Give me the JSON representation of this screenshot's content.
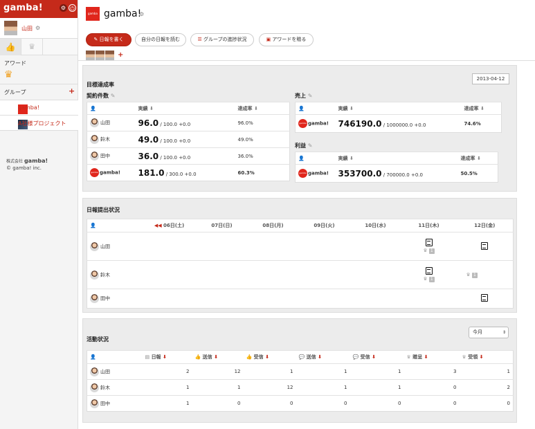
{
  "app": {
    "logo": "gamba!",
    "brand_color": "#c52a1a"
  },
  "sidebar": {
    "user_name": "山田",
    "awards_heading": "アワード",
    "groups_heading": "グループ",
    "groups": [
      {
        "label": "gamba!"
      },
      {
        "label": "A社様プロジェクト"
      }
    ],
    "company_label": "株式会社",
    "company_logo": "gamba!",
    "copyright": "© gamba! inc."
  },
  "header": {
    "title": "gamba!",
    "brand_badge": "gamba",
    "buttons": [
      {
        "label": "日報を書く",
        "icon": "pencil-icon"
      },
      {
        "label": "自分の日報を読む"
      },
      {
        "label": "グループの進捗状況",
        "icon": "list-icon"
      },
      {
        "label": "アワードを贈る",
        "icon": "gift-icon"
      }
    ]
  },
  "goals": {
    "title": "目標達成率",
    "date": "2013-04-12",
    "contracts": {
      "title": "契約件数",
      "col_actual": "実績",
      "col_rate": "達成率",
      "rows": [
        {
          "name": "山田",
          "actual": "96.0",
          "target": "/ 100.0 +0.0",
          "rate": "96.0%"
        },
        {
          "name": "鈴木",
          "actual": "49.0",
          "target": "/ 100.0 +0.0",
          "rate": "49.0%"
        },
        {
          "name": "田中",
          "actual": "36.0",
          "target": "/ 100.0 +0.0",
          "rate": "36.0%"
        },
        {
          "name": "gamba!",
          "actual": "181.0",
          "target": "/ 300.0 +0.0",
          "rate": "60.3%"
        }
      ]
    },
    "sales": {
      "title": "売上",
      "col_actual": "実績",
      "col_rate": "達成率",
      "rows": [
        {
          "name": "gamba!",
          "actual": "746190.0",
          "target": "/ 1000000.0 +0.0",
          "rate": "74.6%"
        }
      ]
    },
    "profit": {
      "title": "利益",
      "col_actual": "実績",
      "col_rate": "達成率",
      "rows": [
        {
          "name": "gamba!",
          "actual": "353700.0",
          "target": "/ 700000.0 +0.0",
          "rate": "50.5%"
        }
      ]
    }
  },
  "reports": {
    "title": "日報提出状況",
    "days": [
      "06日(土)",
      "07日(日)",
      "08日(月)",
      "09日(火)",
      "10日(水)",
      "11日(木)",
      "12日(金)"
    ],
    "rows": [
      {
        "name": "山田",
        "d11": "1",
        "d12": ""
      },
      {
        "name": "鈴木",
        "d11": "1",
        "d12": "1"
      },
      {
        "name": "田中",
        "d11": "",
        "d12": ""
      }
    ]
  },
  "activity": {
    "title": "活動状況",
    "period": "今月",
    "columns": [
      "日報",
      "送信",
      "受信",
      "送信",
      "受信",
      "贈呈",
      "受領"
    ],
    "rows": [
      {
        "name": "山田",
        "values": [
          "2",
          "12",
          "1",
          "1",
          "1",
          "3",
          "1"
        ]
      },
      {
        "name": "鈴木",
        "values": [
          "1",
          "1",
          "12",
          "1",
          "1",
          "0",
          "2"
        ]
      },
      {
        "name": "田中",
        "values": [
          "1",
          "0",
          "0",
          "0",
          "0",
          "0",
          "0"
        ]
      }
    ]
  }
}
